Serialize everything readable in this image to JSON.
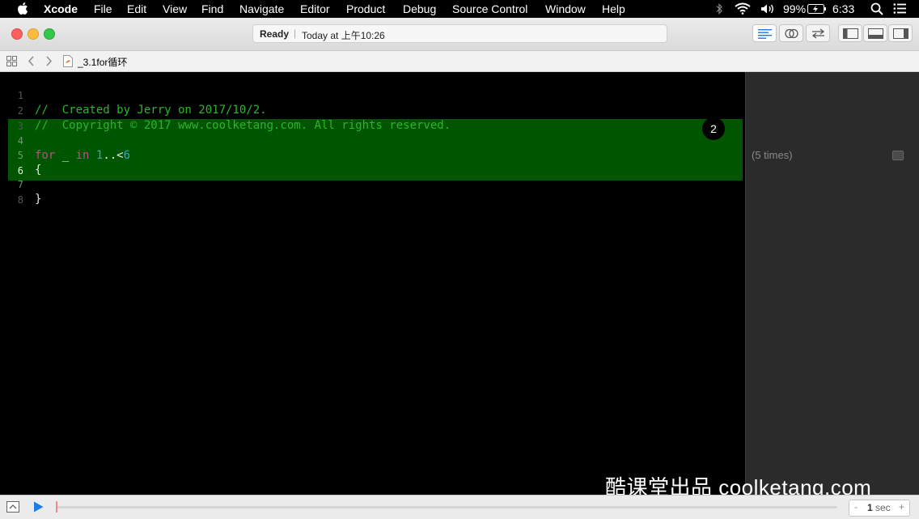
{
  "menubar": {
    "app_name": "Xcode",
    "items": [
      "File",
      "Edit",
      "View",
      "Find",
      "Navigate",
      "Editor",
      "Product",
      "Debug",
      "Source Control",
      "Window",
      "Help"
    ],
    "battery": "99%",
    "clock": "6:33"
  },
  "toolbar": {
    "status": "Ready",
    "separator": "|",
    "timestamp": "Today at 上午10:26"
  },
  "jumpbar": {
    "filename": "_3.1for循环"
  },
  "editor": {
    "lines": [
      {
        "num": "1",
        "text": "//  Created by Jerry on 2017/10/2."
      },
      {
        "num": "2",
        "text": "//  Copyright © 2017 www.coolketang.com. All rights reserved."
      },
      {
        "num": "3",
        "text": ""
      },
      {
        "num": "4",
        "kw": "for",
        "mid": " _ ",
        "kw2": "in",
        "sp": " ",
        "range_start": "1",
        "range_op": "..<",
        "range_end": "6"
      },
      {
        "num": "5",
        "text": "{"
      },
      {
        "num": "6",
        "text": ""
      },
      {
        "num": "7",
        "text": "}"
      },
      {
        "num": "8",
        "text": ""
      }
    ],
    "badge": "2"
  },
  "results": {
    "loop_result": "(5 times)"
  },
  "bottom": {
    "minus": "-",
    "duration_value": "1",
    "duration_unit": "sec",
    "plus": "+"
  },
  "watermark": "酷课堂出品 coolketang.com",
  "colors": {
    "comment": "#2bb52b",
    "keyword": "#b8508a",
    "number": "#3aa3c2",
    "plain": "#e8e8e8",
    "highlight_bg": "#005500"
  }
}
